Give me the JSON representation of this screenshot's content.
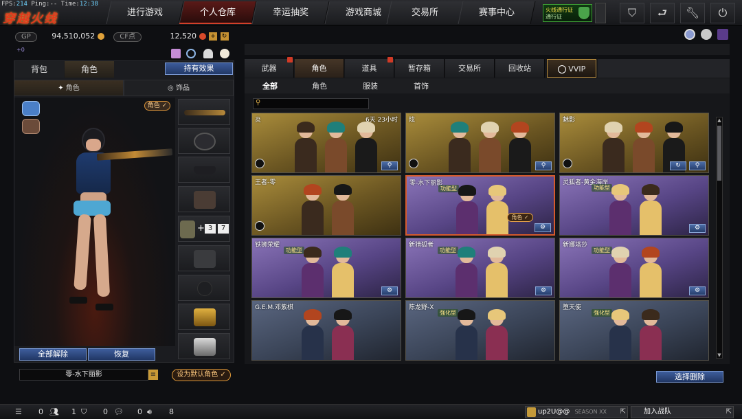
{
  "topbar": {
    "fps_label": "FPS:",
    "fps_value": "214",
    "ping_label": "Ping:--",
    "time_label": "Time:",
    "time_value": "12:38",
    "logo_text": "穿越火线",
    "nav": [
      "进行游戏",
      "个人仓库",
      "幸运抽奖",
      "游戏商城",
      "交易所",
      "赛事中心"
    ],
    "active_nav": 1,
    "pass_badge": "火线通行证",
    "pass_sub": "通行证"
  },
  "currency": {
    "gp_label": "GP",
    "gp_value": "94,510,052",
    "cf_label": "CF点",
    "cf_value": "12,520",
    "link_label": "+0"
  },
  "left": {
    "tabs": [
      "背包",
      "角色"
    ],
    "active_tab": 1,
    "hold_effect": "持有效果",
    "subtabs": [
      "角色",
      "饰品"
    ],
    "role_tag": "角色 ✓",
    "slot_tags": [
      "3",
      "7"
    ],
    "unequip_all": "全部解除",
    "restore": "恢复",
    "char_name": "零-水下丽影",
    "set_default": "设为默认角色 ✓"
  },
  "right": {
    "tabs": [
      "武器",
      "角色",
      "道具",
      "暂存箱",
      "交易所",
      "回收站",
      "VVIP"
    ],
    "active_tab": 1,
    "filters": [
      "全部",
      "角色",
      "服装",
      "首饰"
    ],
    "active_filter": 0,
    "search_placeholder": "",
    "select_delete": "选择删除",
    "cards": [
      {
        "title": "炎",
        "time": "6天 23小时",
        "theme": "gold",
        "type": "",
        "tag": "",
        "buttons": [
          "search"
        ]
      },
      {
        "title": "炫",
        "time": "",
        "theme": "gold",
        "type": "",
        "tag": "",
        "buttons": [
          "search"
        ]
      },
      {
        "title": "魅影",
        "time": "",
        "theme": "gold",
        "type": "",
        "tag": "",
        "buttons": [
          "refresh",
          "search"
        ]
      },
      {
        "title": "王者-零",
        "time": "",
        "theme": "gold",
        "type": "",
        "tag": "",
        "buttons": []
      },
      {
        "title": "零-水下丽影",
        "time": "",
        "theme": "purple",
        "type": "功能型",
        "tag": "角色 ✓",
        "buttons": [
          "settings"
        ],
        "selected": true
      },
      {
        "title": "灵狐者-黄金海岸",
        "time": "",
        "theme": "purple",
        "type": "功能型",
        "tag": "",
        "buttons": [
          "settings"
        ]
      },
      {
        "title": "铁狮荣耀",
        "time": "",
        "theme": "purple",
        "type": "功能型",
        "tag": "",
        "buttons": [
          "settings"
        ]
      },
      {
        "title": "新猎狐者",
        "time": "",
        "theme": "purple",
        "type": "功能型",
        "tag": "",
        "buttons": [
          "settings"
        ]
      },
      {
        "title": "新娜塔莎",
        "time": "",
        "theme": "purple",
        "type": "功能型",
        "tag": "",
        "buttons": [
          "settings"
        ]
      },
      {
        "title": "G.E.M.邓紫棋",
        "time": "",
        "theme": "blue",
        "type": "",
        "tag": "",
        "buttons": []
      },
      {
        "title": "陈龙野-X",
        "time": "",
        "theme": "blue",
        "type": "强化型",
        "tag": "",
        "buttons": []
      },
      {
        "title": "堕天使",
        "time": "",
        "theme": "blue",
        "type": "强化型",
        "tag": "",
        "buttons": []
      }
    ]
  },
  "bottom": {
    "counts": [
      "0",
      "1",
      "0",
      "0",
      "8"
    ],
    "user": "up2U@@",
    "season": "SEASON XX",
    "join_team": "加入战队"
  },
  "colors": {
    "accent_red": "#d2402a",
    "gold_card": "#a98c3b",
    "purple_card": "#8a74b8",
    "blue_button": "#3e5d9c"
  }
}
